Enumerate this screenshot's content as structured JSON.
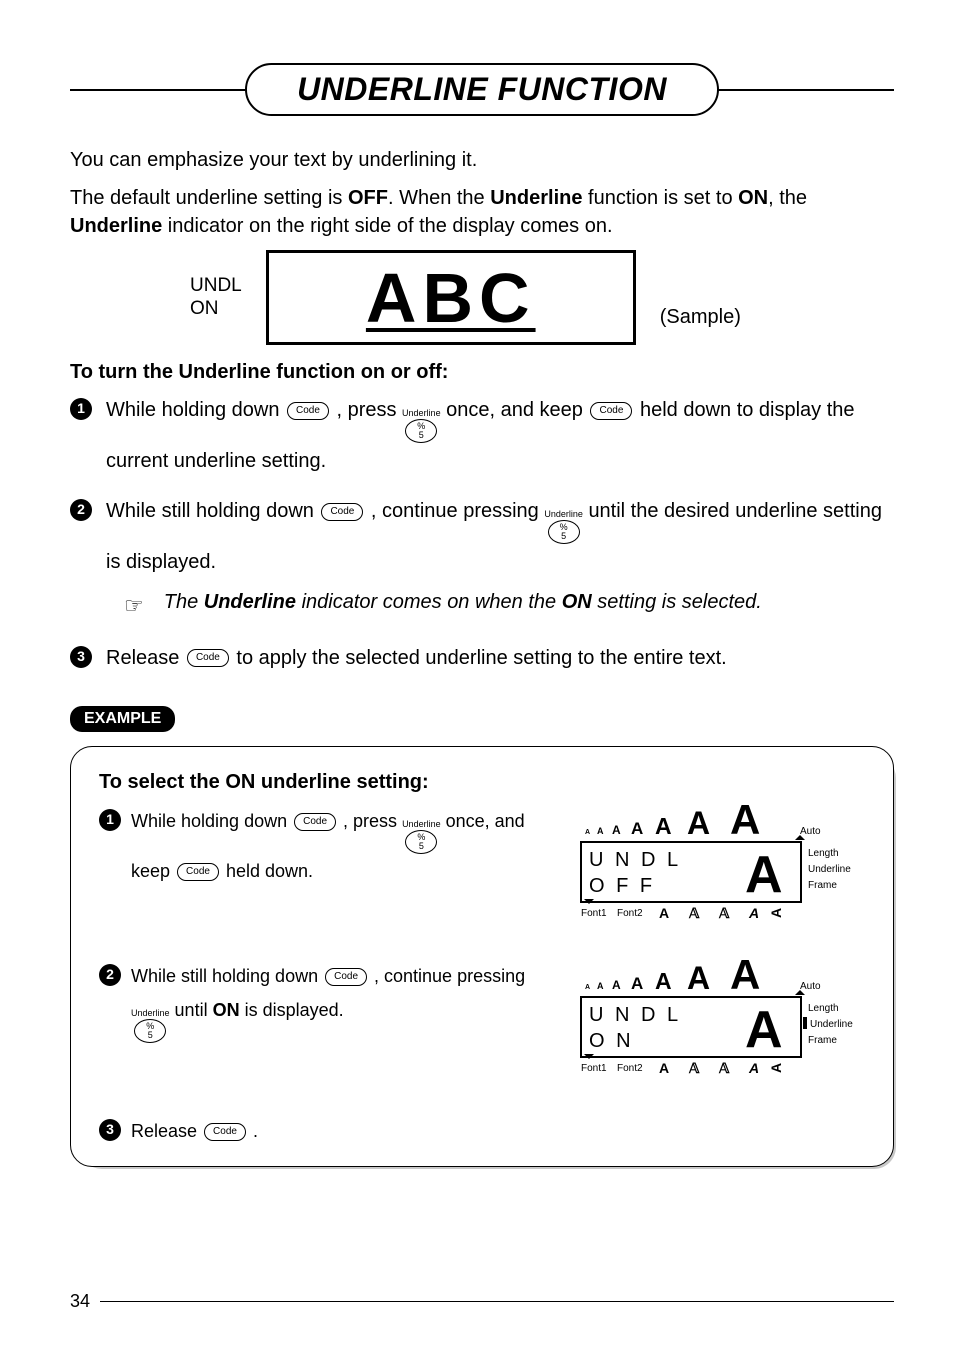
{
  "title": "UNDERLINE FUNCTION",
  "intro1": "You can emphasize your text by underlining it.",
  "intro2_parts": {
    "a": "The default underline setting is ",
    "b": "OFF",
    "c": ". When the ",
    "d": "Underline",
    "e": " function is set to ",
    "f": "ON",
    "g": ", the ",
    "h": "Underline",
    "i": " indicator on the right side of the display comes on."
  },
  "sample_label": "UNDL\nON",
  "lcd_text": "ABC",
  "sample_word": "(Sample)",
  "section_head": "To turn the Underline function on or off:",
  "key_code": "Code",
  "key_underline_top": "Underline",
  "key_underline_percent": "%",
  "key_underline_5": "5",
  "steps": {
    "s1": {
      "num": "1",
      "a": "While holding down ",
      "b": ", press ",
      "c": " once, and keep ",
      "d": " held down to display the current underline setting."
    },
    "s2": {
      "num": "2",
      "a": "While still holding down ",
      "b": ", continue pressing ",
      "c": " until the desired underline setting is displayed."
    },
    "note": {
      "a": "The ",
      "b": "Underline",
      "c": " indicator comes on when the ",
      "d": "ON",
      "e": " setting is selected."
    },
    "s3": {
      "num": "3",
      "a": "Release ",
      "b": " to apply the selected underline setting to the entire text."
    }
  },
  "example_label": "EXAMPLE",
  "ex_title": "To select the ON underline setting:",
  "ex_rows": {
    "r1": {
      "num": "1",
      "a": "While holding down ",
      "b": ", press ",
      "c": " once, and keep ",
      "d": " held down."
    },
    "r2": {
      "num": "2",
      "a": "While still holding down ",
      "b": ", continue pressing ",
      "c": " until ",
      "d": "ON",
      "e": " is displayed."
    },
    "r3": {
      "num": "3",
      "a": "Release ",
      "b": "."
    }
  },
  "device": {
    "auto": "Auto",
    "length": "Length",
    "underline": "Underline",
    "frame": "Frame",
    "font1": "Font1",
    "font2": "Font2",
    "line1_off": "U N D L",
    "line2_off": "O F F",
    "line1_on": "U N D L",
    "line2_on": "O N",
    "bigA": "A"
  },
  "page_num": "34"
}
